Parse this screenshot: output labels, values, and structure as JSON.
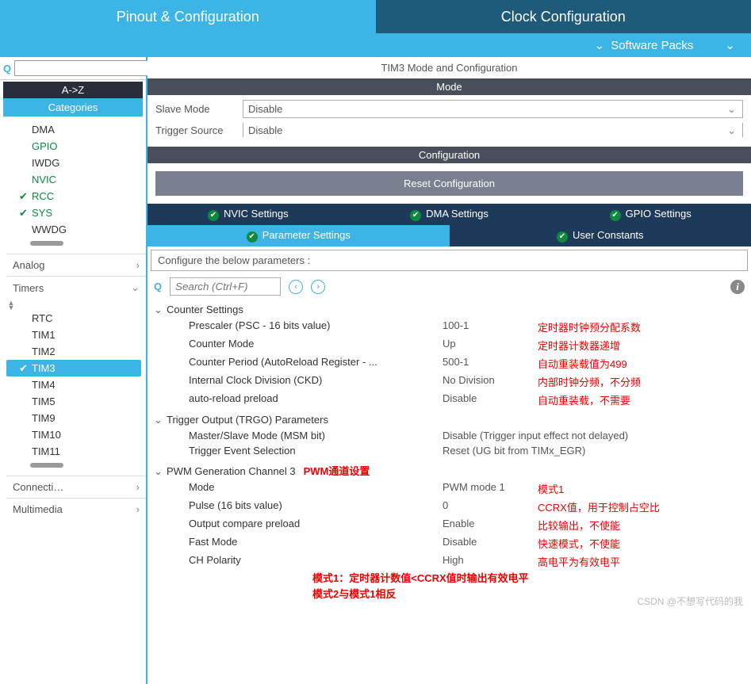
{
  "topTabs": {
    "pinout": "Pinout & Configuration",
    "clock": "Clock Configuration"
  },
  "softwarePacks": "Software Packs",
  "leftSearchPlaceholder": "",
  "az": "A->Z",
  "categoriesLabel": "Categories",
  "treeTop": [
    {
      "label": "DMA",
      "green": false,
      "checked": false
    },
    {
      "label": "GPIO",
      "green": true,
      "checked": false
    },
    {
      "label": "IWDG",
      "green": false,
      "checked": false
    },
    {
      "label": "NVIC",
      "green": true,
      "checked": false
    },
    {
      "label": "RCC",
      "green": true,
      "checked": true
    },
    {
      "label": "SYS",
      "green": true,
      "checked": true
    },
    {
      "label": "WWDG",
      "green": false,
      "checked": false
    }
  ],
  "catAnalog": "Analog",
  "catTimers": "Timers",
  "timers": [
    {
      "label": "RTC",
      "selected": false
    },
    {
      "label": "TIM1",
      "selected": false
    },
    {
      "label": "TIM2",
      "selected": false
    },
    {
      "label": "TIM3",
      "selected": true
    },
    {
      "label": "TIM4",
      "selected": false
    },
    {
      "label": "TIM5",
      "selected": false
    },
    {
      "label": "TIM9",
      "selected": false
    },
    {
      "label": "TIM10",
      "selected": false
    },
    {
      "label": "TIM11",
      "selected": false
    }
  ],
  "catConnect": "Connecti…",
  "catMultimedia": "Multimedia",
  "panelTitle": "TIM3 Mode and Configuration",
  "modeHeader": "Mode",
  "modeRows": {
    "slaveLabel": "Slave Mode",
    "slaveValue": "Disable",
    "triggerLabel": "Trigger Source",
    "triggerValue": "Disable"
  },
  "configHeader": "Configuration",
  "resetBtn": "Reset Configuration",
  "tabsRow1": {
    "nvic": "NVIC Settings",
    "dma": "DMA Settings",
    "gpio": "GPIO Settings"
  },
  "tabsRow2": {
    "param": "Parameter Settings",
    "user": "User Constants"
  },
  "configureHint": "Configure the below parameters :",
  "paramSearchPlaceholder": "Search (Ctrl+F)",
  "groups": {
    "counter": {
      "title": "Counter Settings",
      "rows": [
        {
          "label": "Prescaler (PSC - 16 bits value)",
          "value": "100-1",
          "annot": "定时器时钟预分配系数"
        },
        {
          "label": "Counter Mode",
          "value": "Up",
          "annot": "定时器计数器递增"
        },
        {
          "label": "Counter Period (AutoReload Register - ...",
          "value": "500-1",
          "annot": "自动重装载值为499"
        },
        {
          "label": "Internal Clock Division (CKD)",
          "value": "No Division",
          "annot": "内部时钟分频，不分频"
        },
        {
          "label": "auto-reload preload",
          "value": "Disable",
          "annot": "自动重装载，不需要"
        }
      ]
    },
    "trgo": {
      "title": "Trigger Output (TRGO) Parameters",
      "rows": [
        {
          "label": "Master/Slave Mode (MSM bit)",
          "value": "Disable (Trigger input effect not delayed)",
          "annot": ""
        },
        {
          "label": "Trigger Event Selection",
          "value": "Reset (UG bit from TIMx_EGR)",
          "annot": ""
        }
      ]
    },
    "pwm": {
      "title": "PWM Generation Channel 3",
      "titleAnnot": "PWM通道设置",
      "rows": [
        {
          "label": "Mode",
          "value": "PWM mode 1",
          "annot": "模式1"
        },
        {
          "label": "Pulse (16 bits value)",
          "value": "0",
          "annot": "CCRX值，用于控制占空比"
        },
        {
          "label": "Output compare preload",
          "value": "Enable",
          "annot": "比较输出，不使能"
        },
        {
          "label": "Fast Mode",
          "value": "Disable",
          "annot": "快速模式，不使能"
        },
        {
          "label": "CH Polarity",
          "value": "High",
          "annot": "高电平为有效电平"
        }
      ]
    }
  },
  "notes": {
    "line1": "模式1：定时器计数值<CCRX值时输出有效电平",
    "line2": "模式2与模式1相反"
  },
  "watermark": "CSDN @不想写代码的我"
}
